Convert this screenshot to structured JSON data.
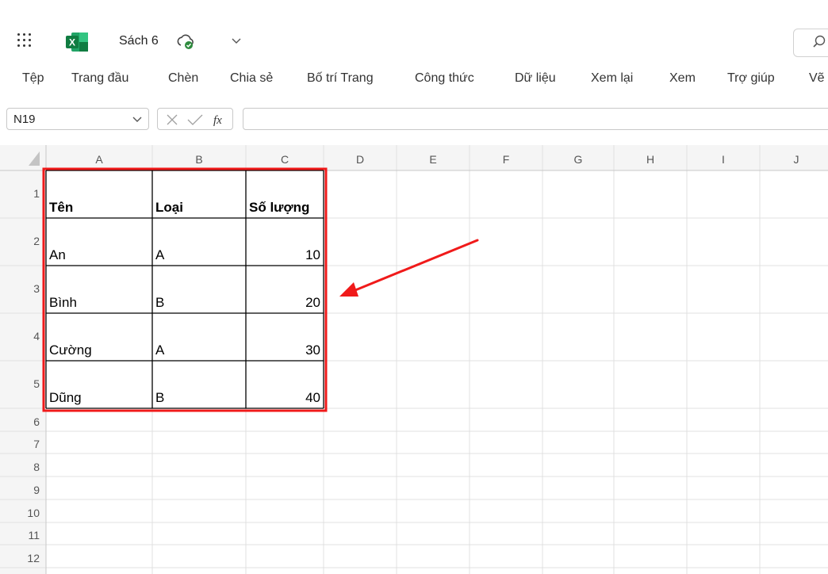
{
  "app": {
    "name": "Excel",
    "logo_letter": "X",
    "document_title": "Sách 6",
    "brand_color": "#107c41",
    "accent_color": "#f01a1a"
  },
  "ribbon": {
    "tabs": [
      "Tệp",
      "Trang đầu",
      "Chèn",
      "Chia sẻ",
      "Bố trí Trang",
      "Công thức",
      "Dữ liệu",
      "Xem lại",
      "Xem",
      "Trợ giúp",
      "Vẽ"
    ]
  },
  "formula_bar": {
    "cell_reference": "N19",
    "formula_value": "",
    "fx_label": "fx"
  },
  "sheet": {
    "columns": [
      "A",
      "B",
      "C",
      "D",
      "E",
      "F",
      "G",
      "H",
      "I",
      "J"
    ],
    "rows": [
      "1",
      "2",
      "3",
      "4",
      "5",
      "6",
      "7",
      "8",
      "9",
      "10",
      "11",
      "12"
    ],
    "table_headers": [
      "Tên",
      "Loại",
      "Số lượng"
    ],
    "table_rows": [
      [
        "An",
        "A",
        "10"
      ],
      [
        "Bình",
        "B",
        "20"
      ],
      [
        "Cường",
        "A",
        "30"
      ],
      [
        "Dũng",
        "B",
        "40"
      ]
    ]
  },
  "annotation": {
    "highlight": "table A1:C5 outlined in red",
    "arrow_color": "#f01a1a"
  }
}
